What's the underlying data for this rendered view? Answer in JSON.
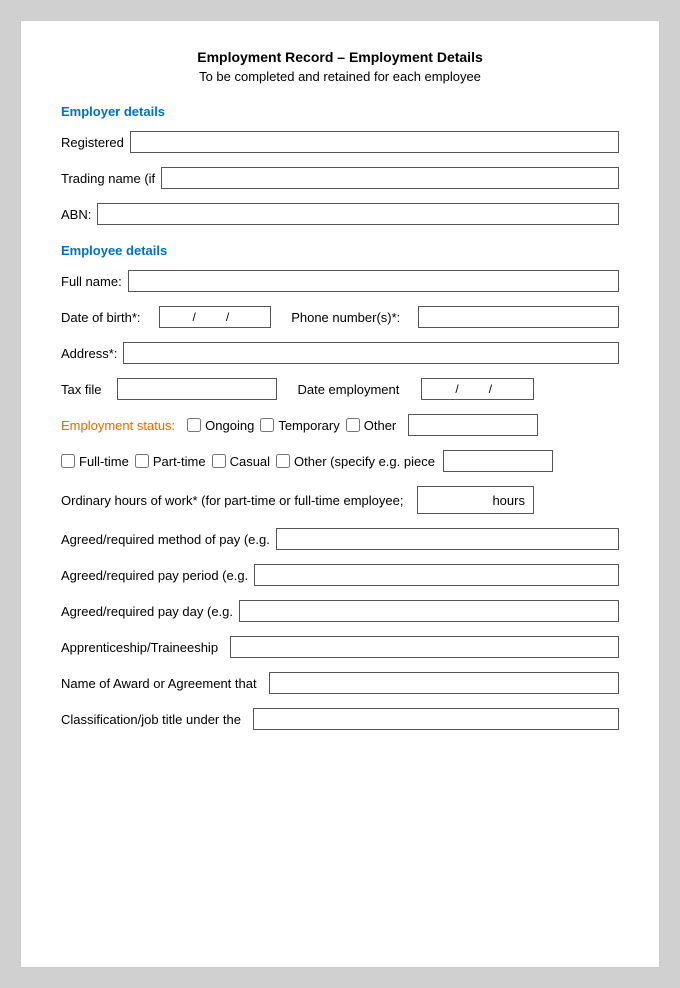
{
  "header": {
    "title": "Employment Record – Employment Details",
    "subtitle": "To be completed and retained for each employee"
  },
  "employer_section": {
    "heading": "Employer details",
    "registered_label": "Registered",
    "trading_label": "Trading name (if",
    "abn_label": "ABN:"
  },
  "employee_section": {
    "heading": "Employee details",
    "fullname_label": "Full name:",
    "dob_label": "Date of birth*:",
    "phone_label": "Phone number(s)*:",
    "address_label": "Address*:",
    "tax_file_label": "Tax file",
    "date_employment_label": "Date employment",
    "emp_status_label": "Employment status:",
    "ongoing_label": "Ongoing",
    "temporary_label": "Temporary",
    "other_label": "Other",
    "fulltime_label": "Full-time",
    "parttime_label": "Part-time",
    "casual_label": "Casual",
    "other_specify_label": "Other (specify e.g. piece",
    "ordinary_hours_label": "Ordinary hours of work* (for part-time or full-time employee;",
    "hours_label": "hours",
    "pay_method_label": "Agreed/required method of pay (e.g.",
    "pay_period_label": "Agreed/required pay period (e.g.",
    "pay_day_label": "Agreed/required pay day (e.g.",
    "apprenticeship_label": "Apprenticeship/Traineeship",
    "award_label": "Name of Award or Agreement that",
    "classification_label": "Classification/job title under the"
  }
}
